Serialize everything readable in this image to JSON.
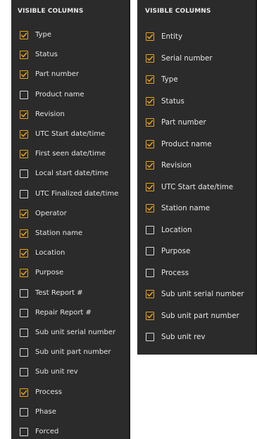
{
  "left_panel": {
    "title": "VISIBLE COLUMNS",
    "items": [
      {
        "label": "Type",
        "checked": true
      },
      {
        "label": "Status",
        "checked": true
      },
      {
        "label": "Part number",
        "checked": true
      },
      {
        "label": "Product name",
        "checked": false
      },
      {
        "label": "Revision",
        "checked": true
      },
      {
        "label": "UTC Start date/time",
        "checked": true
      },
      {
        "label": "First seen date/time",
        "checked": true
      },
      {
        "label": "Local start date/time",
        "checked": false
      },
      {
        "label": "UTC Finalized date/time",
        "checked": false
      },
      {
        "label": "Operator",
        "checked": true
      },
      {
        "label": "Station name",
        "checked": true
      },
      {
        "label": "Location",
        "checked": true
      },
      {
        "label": "Purpose",
        "checked": true
      },
      {
        "label": "Test Report #",
        "checked": false
      },
      {
        "label": "Repair Report #",
        "checked": false
      },
      {
        "label": "Sub unit serial number",
        "checked": false
      },
      {
        "label": "Sub unit part number",
        "checked": false
      },
      {
        "label": "Sub unit rev",
        "checked": false
      },
      {
        "label": "Process",
        "checked": true
      },
      {
        "label": "Phase",
        "checked": false
      },
      {
        "label": "Forced",
        "checked": false
      }
    ]
  },
  "right_panel": {
    "title": "VISIBLE COLUMNS",
    "items": [
      {
        "label": "Entity",
        "checked": true
      },
      {
        "label": "Serial number",
        "checked": true
      },
      {
        "label": "Type",
        "checked": true
      },
      {
        "label": "Status",
        "checked": true
      },
      {
        "label": "Part number",
        "checked": true
      },
      {
        "label": "Product name",
        "checked": true
      },
      {
        "label": "Revision",
        "checked": true
      },
      {
        "label": "UTC Start date/time",
        "checked": true
      },
      {
        "label": "Station name",
        "checked": true
      },
      {
        "label": "Location",
        "checked": false
      },
      {
        "label": "Purpose",
        "checked": false
      },
      {
        "label": "Process",
        "checked": false
      },
      {
        "label": "Sub unit serial number",
        "checked": true
      },
      {
        "label": "Sub unit part number",
        "checked": true
      },
      {
        "label": "Sub unit rev",
        "checked": false
      }
    ]
  },
  "colors": {
    "panel_bg": "#2b2b2b",
    "checkbox_checked": "#e8a317",
    "checkbox_unchecked": "#d9d9d9",
    "text": "#e6e6e6"
  }
}
